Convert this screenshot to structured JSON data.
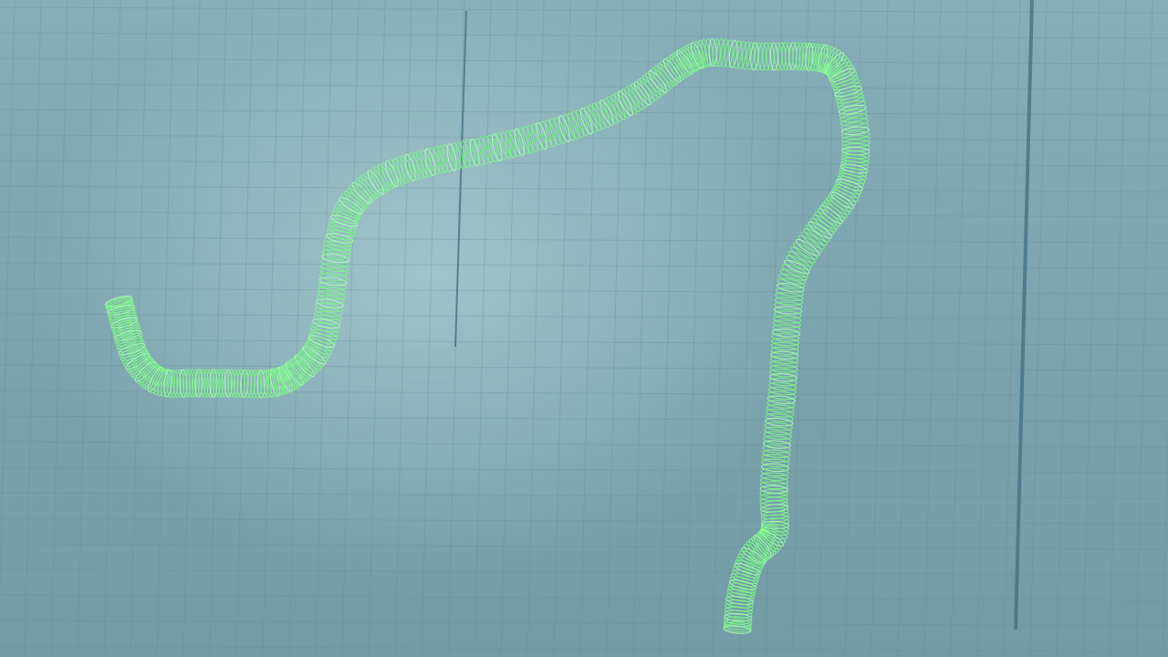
{
  "viewport": {
    "background_color": "#7aa0aa",
    "grid_color": "#5f8893",
    "axis_line_color": "#3f6f80",
    "tube_color": "#7cf58a",
    "tube_highlight_color": "#a8ffb2"
  },
  "scene": {
    "object": "helical-wireframe-tube",
    "grid_visible": true,
    "text_labels": []
  }
}
